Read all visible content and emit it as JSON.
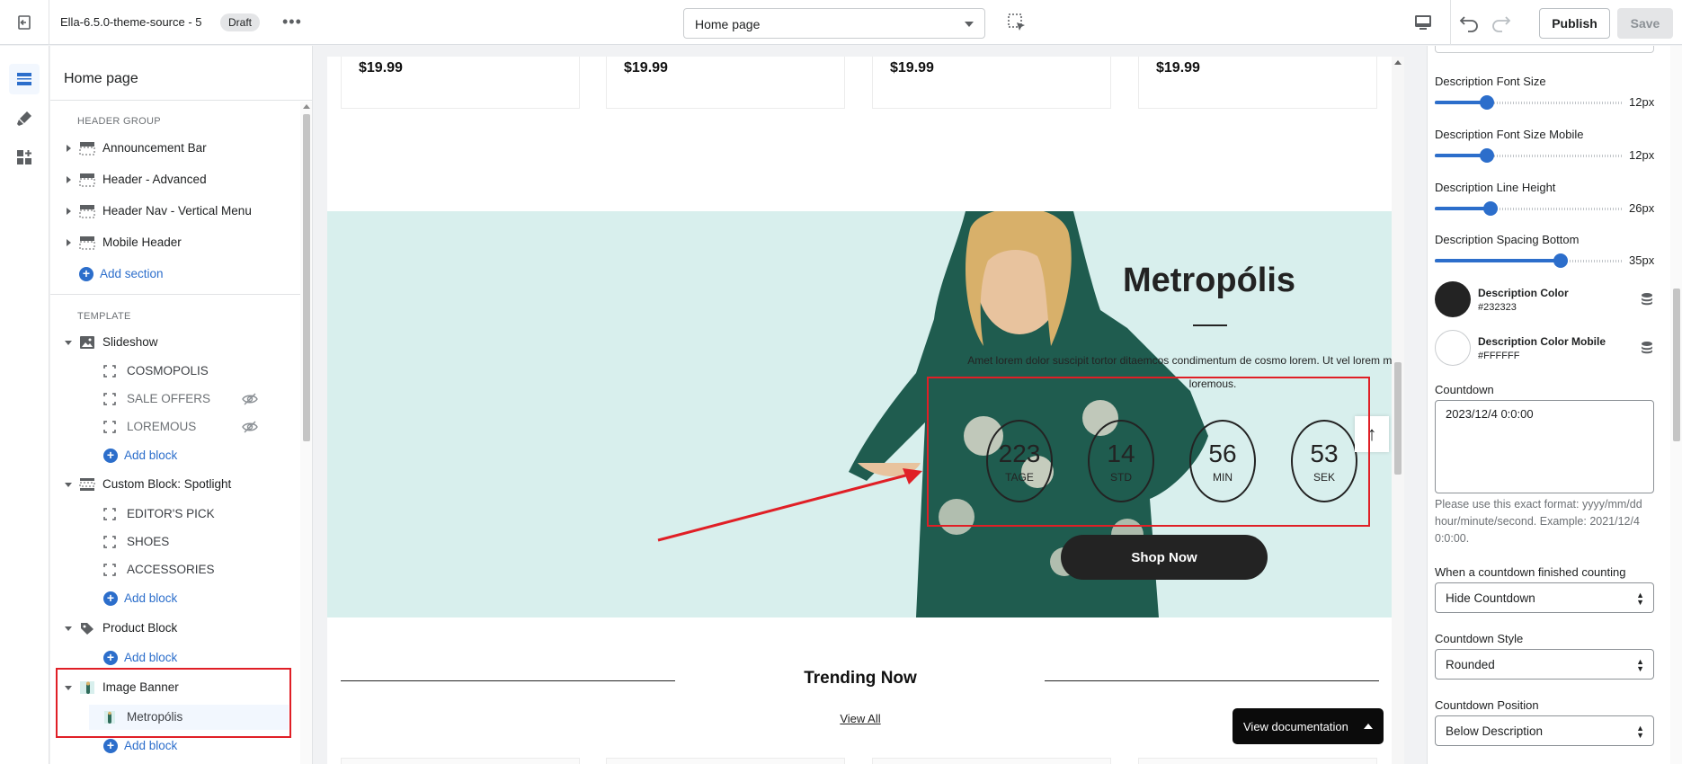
{
  "topbar": {
    "theme_name": "Ella-6.5.0-theme-source - 5",
    "status_badge": "Draft",
    "more_label": "•••",
    "page_selector": "Home page",
    "publish_label": "Publish",
    "save_label": "Save"
  },
  "sidebar": {
    "title": "Home page",
    "header_group_label": "HEADER GROUP",
    "header_sections": [
      {
        "label": "Announcement Bar"
      },
      {
        "label": "Header - Advanced"
      },
      {
        "label": "Header Nav - Vertical Menu"
      },
      {
        "label": "Mobile Header"
      }
    ],
    "add_section_label": "Add section",
    "template_label": "TEMPLATE",
    "slideshow": {
      "label": "Slideshow",
      "blocks": [
        "COSMOPOLIS",
        "SALE OFFERS",
        "LOREMOUS"
      ],
      "add_block": "Add block"
    },
    "spotlight": {
      "label": "Custom Block: Spotlight",
      "blocks": [
        "EDITOR'S PICK",
        "SHOES",
        "ACCESSORIES"
      ],
      "add_block": "Add block"
    },
    "product_block": {
      "label": "Product Block",
      "add_block": "Add block"
    },
    "image_banner": {
      "label": "Image Banner",
      "blocks": [
        "Metropólis"
      ],
      "add_block": "Add block"
    }
  },
  "preview": {
    "prices": [
      "$19.99",
      "$19.99",
      "$19.99",
      "$19.99"
    ],
    "banner": {
      "title": "Metropólis",
      "description": "Amet lorem dolor suscipit tortor ditaemcos condimentum de cosmo lorem. Ut vel lorem menean diverra loremous.",
      "countdown": [
        {
          "num": "223",
          "unit": "TAGE"
        },
        {
          "num": "14",
          "unit": "STD"
        },
        {
          "num": "56",
          "unit": "MIN"
        },
        {
          "num": "53",
          "unit": "SEK"
        }
      ],
      "button": "Shop Now",
      "back_to_top": "↑"
    },
    "trending_title": "Trending Now",
    "view_all": "View All",
    "view_documentation": "View documentation"
  },
  "settings": {
    "sliders": [
      {
        "label": "Description Font Size",
        "value": "12px",
        "fraction": 0.26
      },
      {
        "label": "Description Font Size Mobile",
        "value": "12px",
        "fraction": 0.26
      },
      {
        "label": "Description Line Height",
        "value": "26px",
        "fraction": 0.28
      },
      {
        "label": "Description Spacing Bottom",
        "value": "35px",
        "fraction": 0.69
      }
    ],
    "colors": [
      {
        "label": "Description Color",
        "hex": "#232323"
      },
      {
        "label": "Description Color Mobile",
        "hex": "#FFFFFF"
      }
    ],
    "countdown_label": "Countdown",
    "countdown_value": "2023/12/4 0:0:00",
    "countdown_help": "Please use this exact format: yyyy/mm/dd hour/minute/second. Example: 2021/12/4 0:0:00.",
    "finished_label": "When a countdown finished counting",
    "finished_value": "Hide Countdown",
    "style_label": "Countdown Style",
    "style_value": "Rounded",
    "position_label": "Countdown Position",
    "position_value": "Below Description"
  },
  "colors": {
    "accent": "#2c6ecb",
    "annotation_red": "#e01f26",
    "banner_bg": "#d8efed",
    "dark": "#232323"
  }
}
